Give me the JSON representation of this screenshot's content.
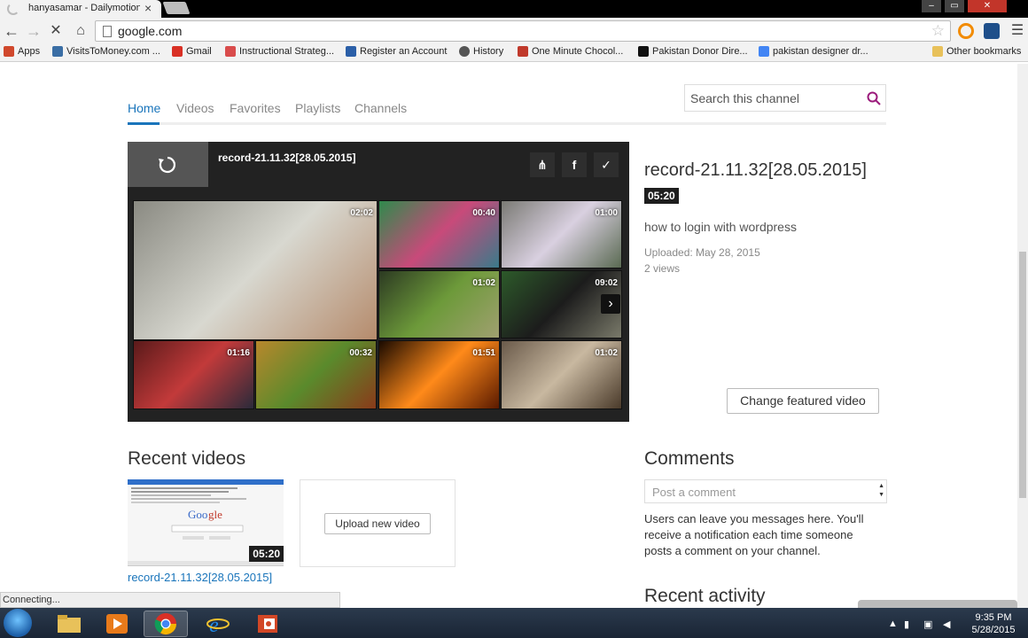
{
  "browser": {
    "tab_title": "hanyasamar - Dailymotion",
    "url": "google.com",
    "bookmarks": [
      {
        "label": "Apps",
        "icon": "apps-grid-icon",
        "color": "#d0482c"
      },
      {
        "label": "VisitsToMoney.com ...",
        "icon": "monitor-icon",
        "color": "#3a6ea5"
      },
      {
        "label": "Gmail",
        "icon": "gmail-icon",
        "color": "#d93025"
      },
      {
        "label": "Instructional Strateg...",
        "icon": "page-icon",
        "color": "#d94c4c"
      },
      {
        "label": "Register an Account",
        "icon": "gem-icon",
        "color": "#2b5fa8"
      },
      {
        "label": "History",
        "icon": "clock-icon",
        "color": "#555555"
      },
      {
        "label": "One Minute Chocol...",
        "icon": "choco-icon",
        "color": "#c0392b"
      },
      {
        "label": "Pakistan Donor Dire...",
        "icon": "donor-icon",
        "color": "#111111"
      },
      {
        "label": "pakistan designer dr...",
        "icon": "google-icon",
        "color": "#4285f4"
      }
    ],
    "other_bookmarks": "Other bookmarks",
    "status": "Connecting..."
  },
  "channel": {
    "nav": [
      "Home",
      "Videos",
      "Favorites",
      "Playlists",
      "Channels"
    ],
    "search_placeholder": "Search this channel"
  },
  "player": {
    "title": "record-21.11.32[28.05.2015]",
    "thumbs": [
      {
        "duration": "02:02",
        "colors": [
          "#8a8a82",
          "#d8d8d0",
          "#b58b6c"
        ]
      },
      {
        "duration": "00:40",
        "colors": [
          "#2f8a4c",
          "#c84a7a",
          "#3a7a8a"
        ]
      },
      {
        "duration": "01:00",
        "colors": [
          "#7a7a74",
          "#d9d0e0",
          "#5a6a52"
        ]
      },
      {
        "duration": "01:02",
        "colors": [
          "#2c3a22",
          "#6d9a3a",
          "#a0a070"
        ]
      },
      {
        "duration": "09:02",
        "colors": [
          "#2d5a2a",
          "#1c1c1c",
          "#7a7a6a"
        ]
      },
      {
        "duration": "01:16",
        "colors": [
          "#5a1a1a",
          "#c23a3a",
          "#2a2a3a"
        ]
      },
      {
        "duration": "00:32",
        "colors": [
          "#b8872c",
          "#5a8a2c",
          "#8a3a1a"
        ]
      },
      {
        "duration": "01:51",
        "colors": [
          "#1a0a00",
          "#ff8a1a",
          "#5a1a00"
        ]
      },
      {
        "duration": "01:02",
        "colors": [
          "#6a5a4a",
          "#c8b8a0",
          "#4a3a2a"
        ]
      }
    ]
  },
  "featured": {
    "title": "record-21.11.32[28.05.2015]",
    "duration": "05:20",
    "description": "how to login with wordpress",
    "uploaded": "Uploaded: May 28, 2015",
    "views": "2 views",
    "change_button": "Change featured video"
  },
  "recent": {
    "heading": "Recent videos",
    "video_title": "record-21.11.32[28.05.2015]",
    "video_duration": "05:20",
    "upload_button": "Upload new video"
  },
  "comments": {
    "heading": "Comments",
    "placeholder": "Post a comment",
    "info": "Users can leave you messages here. You'll receive a notification each time someone posts a comment on your channel."
  },
  "activity": {
    "heading": "Recent activity"
  },
  "taskbar": {
    "time": "9:35 PM",
    "date": "5/28/2015",
    "apps": [
      "explorer-icon",
      "media-player-icon",
      "chrome-icon",
      "ie-icon",
      "office-icon"
    ]
  },
  "colors": {
    "accent": "#1a75bb",
    "player_bg": "#222222"
  }
}
